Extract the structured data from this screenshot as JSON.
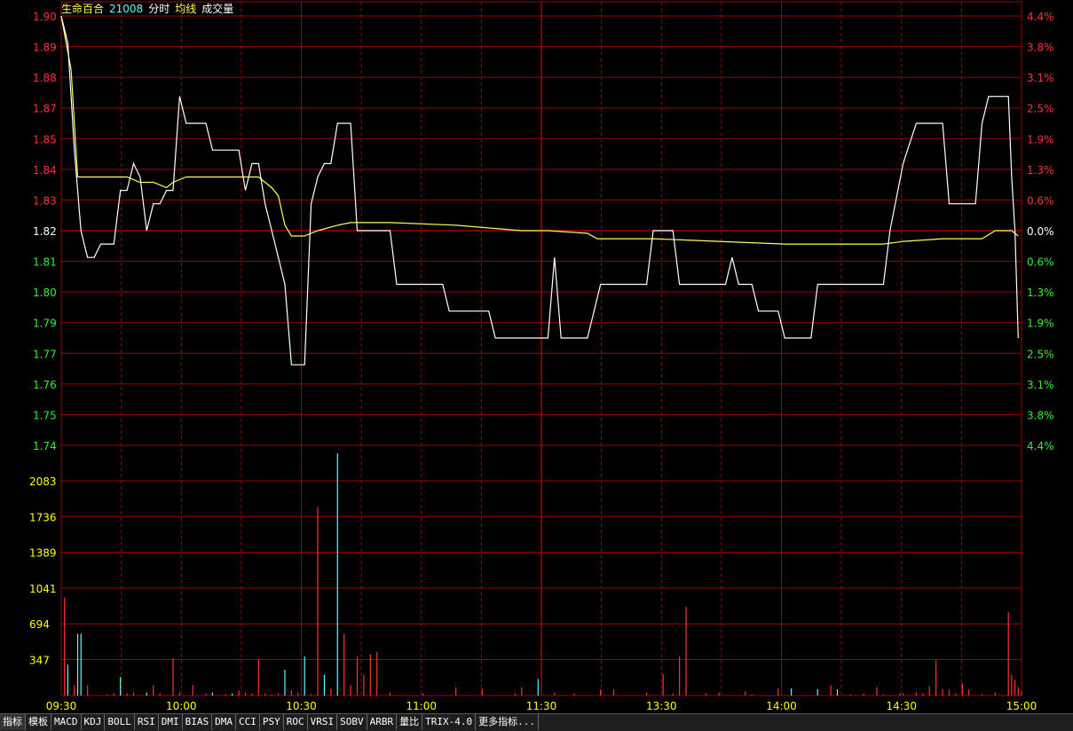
{
  "header": {
    "stock_name": "生命百合",
    "stock_code": "21008",
    "view_label": "分时",
    "avg_label": "均线",
    "vol_label": "成交量"
  },
  "colors": {
    "grid": "#a00000",
    "price_line": "#ffffff",
    "avg_line": "#ffff55",
    "up": "#ff3232",
    "down": "#54ffff",
    "up_label": "#ff3232",
    "down_label": "#33ee33",
    "neutral_label": "#ffffff",
    "vol_label": "#ffff00"
  },
  "chart_data": {
    "type": "line",
    "prev_close": 1.82,
    "price_ticks": [
      "1.90",
      "1.89",
      "1.88",
      "1.87",
      "1.85",
      "1.84",
      "1.83",
      "1.82",
      "1.81",
      "1.80",
      "1.79",
      "1.77",
      "1.76",
      "1.75",
      "1.74"
    ],
    "pct_ticks": [
      "4.4%",
      "3.8%",
      "3.1%",
      "2.5%",
      "1.9%",
      "1.3%",
      "0.6%",
      "0.0%",
      "0.6%",
      "1.3%",
      "1.9%",
      "2.5%",
      "3.1%",
      "3.8%",
      "4.4%"
    ],
    "ylim": [
      1.74,
      1.9
    ],
    "time_ticks": [
      "09:30",
      "10:00",
      "10:30",
      "11:00",
      "11:30",
      "13:30",
      "14:00",
      "14:30",
      "15:00"
    ],
    "volume_ticks": [
      "2083",
      "1736",
      "1389",
      "1041",
      "694",
      "347"
    ],
    "volume_max": 2430,
    "price": [
      [
        0,
        1.9
      ],
      [
        2,
        1.89
      ],
      [
        4,
        1.85
      ],
      [
        6,
        1.82
      ],
      [
        8,
        1.81
      ],
      [
        10,
        1.81
      ],
      [
        12,
        1.815
      ],
      [
        16,
        1.815
      ],
      [
        18,
        1.835
      ],
      [
        20,
        1.835
      ],
      [
        22,
        1.845
      ],
      [
        24,
        1.84
      ],
      [
        26,
        1.82
      ],
      [
        28,
        1.83
      ],
      [
        30,
        1.83
      ],
      [
        32,
        1.835
      ],
      [
        34,
        1.835
      ],
      [
        36,
        1.87
      ],
      [
        38,
        1.86
      ],
      [
        44,
        1.86
      ],
      [
        46,
        1.85
      ],
      [
        54,
        1.85
      ],
      [
        56,
        1.835
      ],
      [
        58,
        1.845
      ],
      [
        60,
        1.845
      ],
      [
        62,
        1.83
      ],
      [
        64,
        1.82
      ],
      [
        66,
        1.81
      ],
      [
        68,
        1.8
      ],
      [
        70,
        1.77
      ],
      [
        74,
        1.77
      ],
      [
        76,
        1.83
      ],
      [
        78,
        1.84
      ],
      [
        80,
        1.845
      ],
      [
        82,
        1.845
      ],
      [
        84,
        1.86
      ],
      [
        88,
        1.86
      ],
      [
        90,
        1.82
      ],
      [
        100,
        1.82
      ],
      [
        102,
        1.8
      ],
      [
        116,
        1.8
      ],
      [
        118,
        1.79
      ],
      [
        130,
        1.79
      ],
      [
        132,
        1.78
      ],
      [
        148,
        1.78
      ],
      [
        150,
        1.81
      ],
      [
        152,
        1.78
      ],
      [
        160,
        1.78
      ],
      [
        164,
        1.8
      ],
      [
        178,
        1.8
      ],
      [
        180,
        1.82
      ],
      [
        186,
        1.82
      ],
      [
        188,
        1.8
      ],
      [
        202,
        1.8
      ],
      [
        204,
        1.81
      ],
      [
        206,
        1.8
      ],
      [
        210,
        1.8
      ],
      [
        212,
        1.79
      ],
      [
        218,
        1.79
      ],
      [
        220,
        1.78
      ],
      [
        228,
        1.78
      ],
      [
        230,
        1.8
      ],
      [
        250,
        1.8
      ],
      [
        252,
        1.82
      ],
      [
        256,
        1.845
      ],
      [
        260,
        1.86
      ],
      [
        268,
        1.86
      ],
      [
        270,
        1.83
      ],
      [
        278,
        1.83
      ],
      [
        280,
        1.86
      ],
      [
        282,
        1.87
      ],
      [
        288,
        1.87
      ],
      [
        289,
        1.84
      ],
      [
        290,
        1.82
      ],
      [
        291,
        1.78
      ]
    ],
    "avg": [
      [
        0,
        1.9
      ],
      [
        3,
        1.88
      ],
      [
        5,
        1.84
      ],
      [
        20,
        1.84
      ],
      [
        24,
        1.838
      ],
      [
        28,
        1.838
      ],
      [
        32,
        1.836
      ],
      [
        34,
        1.838
      ],
      [
        38,
        1.84
      ],
      [
        54,
        1.84
      ],
      [
        60,
        1.84
      ],
      [
        62,
        1.838
      ],
      [
        64,
        1.836
      ],
      [
        66,
        1.833
      ],
      [
        68,
        1.822
      ],
      [
        70,
        1.818
      ],
      [
        74,
        1.818
      ],
      [
        78,
        1.82
      ],
      [
        84,
        1.822
      ],
      [
        88,
        1.823
      ],
      [
        100,
        1.823
      ],
      [
        120,
        1.822
      ],
      [
        140,
        1.82
      ],
      [
        148,
        1.82
      ],
      [
        160,
        1.819
      ],
      [
        163,
        1.817
      ],
      [
        180,
        1.817
      ],
      [
        200,
        1.816
      ],
      [
        220,
        1.815
      ],
      [
        240,
        1.815
      ],
      [
        250,
        1.815
      ],
      [
        256,
        1.816
      ],
      [
        268,
        1.817
      ],
      [
        280,
        1.817
      ],
      [
        284,
        1.82
      ],
      [
        289,
        1.82
      ],
      [
        291,
        1.818
      ]
    ],
    "volume": [
      [
        1,
        950,
        "up"
      ],
      [
        2,
        300,
        "down"
      ],
      [
        4,
        100,
        "up"
      ],
      [
        5,
        600,
        "down"
      ],
      [
        6,
        600,
        "down"
      ],
      [
        8,
        100,
        "up"
      ],
      [
        14,
        10,
        "up"
      ],
      [
        16,
        20,
        "up"
      ],
      [
        18,
        180,
        "down"
      ],
      [
        20,
        20,
        "up"
      ],
      [
        22,
        30,
        "up"
      ],
      [
        26,
        30,
        "down"
      ],
      [
        28,
        100,
        "up"
      ],
      [
        30,
        20,
        "up"
      ],
      [
        34,
        360,
        "up"
      ],
      [
        36,
        30,
        "up"
      ],
      [
        40,
        100,
        "up"
      ],
      [
        44,
        20,
        "up"
      ],
      [
        46,
        30,
        "down"
      ],
      [
        50,
        10,
        "up"
      ],
      [
        52,
        20,
        "down"
      ],
      [
        54,
        50,
        "up"
      ],
      [
        56,
        30,
        "up"
      ],
      [
        58,
        20,
        "up"
      ],
      [
        60,
        350,
        "up"
      ],
      [
        62,
        20,
        "up"
      ],
      [
        64,
        10,
        "up"
      ],
      [
        66,
        20,
        "up"
      ],
      [
        68,
        250,
        "down"
      ],
      [
        70,
        50,
        "up"
      ],
      [
        72,
        30,
        "up"
      ],
      [
        74,
        380,
        "down"
      ],
      [
        76,
        10,
        "up"
      ],
      [
        78,
        1830,
        "up"
      ],
      [
        80,
        200,
        "down"
      ],
      [
        82,
        70,
        "up"
      ],
      [
        84,
        2350,
        "down"
      ],
      [
        86,
        600,
        "up"
      ],
      [
        88,
        100,
        "up"
      ],
      [
        90,
        380,
        "up"
      ],
      [
        92,
        200,
        "up"
      ],
      [
        94,
        400,
        "up"
      ],
      [
        96,
        420,
        "up"
      ],
      [
        100,
        30,
        "up"
      ],
      [
        110,
        20,
        "up"
      ],
      [
        120,
        80,
        "up"
      ],
      [
        128,
        70,
        "up"
      ],
      [
        138,
        20,
        "up"
      ],
      [
        140,
        80,
        "up"
      ],
      [
        145,
        160,
        "down"
      ],
      [
        150,
        30,
        "up"
      ],
      [
        156,
        20,
        "up"
      ],
      [
        164,
        60,
        "up"
      ],
      [
        168,
        60,
        "up"
      ],
      [
        178,
        30,
        "up"
      ],
      [
        183,
        210,
        "up"
      ],
      [
        186,
        20,
        "up"
      ],
      [
        188,
        380,
        "up"
      ],
      [
        190,
        860,
        "up"
      ],
      [
        196,
        20,
        "up"
      ],
      [
        200,
        30,
        "up"
      ],
      [
        208,
        40,
        "up"
      ],
      [
        210,
        10,
        "up"
      ],
      [
        218,
        70,
        "up"
      ],
      [
        222,
        70,
        "down"
      ],
      [
        230,
        60,
        "down"
      ],
      [
        234,
        100,
        "up"
      ],
      [
        236,
        60,
        "down"
      ],
      [
        240,
        10,
        "up"
      ],
      [
        244,
        20,
        "up"
      ],
      [
        248,
        80,
        "up"
      ],
      [
        250,
        10,
        "up"
      ],
      [
        255,
        20,
        "up"
      ],
      [
        256,
        20,
        "up"
      ],
      [
        260,
        30,
        "up"
      ],
      [
        262,
        20,
        "up"
      ],
      [
        264,
        90,
        "up"
      ],
      [
        266,
        340,
        "up"
      ],
      [
        268,
        60,
        "up"
      ],
      [
        270,
        60,
        "up"
      ],
      [
        272,
        20,
        "up"
      ],
      [
        274,
        120,
        "up"
      ],
      [
        276,
        60,
        "up"
      ],
      [
        280,
        10,
        "up"
      ],
      [
        284,
        30,
        "up"
      ],
      [
        288,
        810,
        "up"
      ],
      [
        289,
        200,
        "up"
      ],
      [
        290,
        150,
        "up"
      ],
      [
        291,
        80,
        "up"
      ],
      [
        292,
        40,
        "up"
      ]
    ]
  },
  "tabs": [
    "指标",
    "模板",
    "MACD",
    "KDJ",
    "BOLL",
    "RSI",
    "DMI",
    "BIAS",
    "DMA",
    "CCI",
    "PSY",
    "ROC",
    "VRSI",
    "SOBV",
    "ARBR",
    "量比",
    "TRIX-4.0",
    "更多指标..."
  ]
}
